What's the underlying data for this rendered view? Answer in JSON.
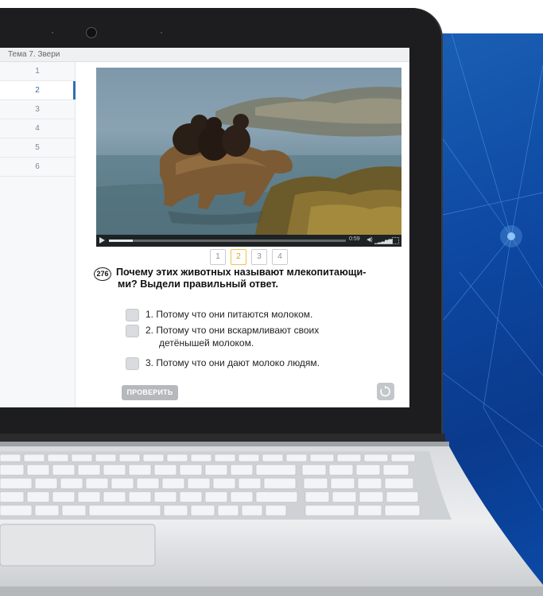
{
  "window": {
    "title": "Тема 7. Звери"
  },
  "sidebar": {
    "items": [
      {
        "label": "1",
        "active": false
      },
      {
        "label": "2",
        "active": true
      },
      {
        "label": "3",
        "active": false
      },
      {
        "label": "4",
        "active": false
      },
      {
        "label": "5",
        "active": false
      },
      {
        "label": "6",
        "active": false
      }
    ]
  },
  "video": {
    "time": "0:59",
    "progress": 0.1,
    "icons": [
      "play-icon",
      "volume-icon",
      "fullscreen-icon"
    ]
  },
  "pager": {
    "pages": [
      "1",
      "2",
      "3",
      "4"
    ],
    "active_page": "2"
  },
  "question": {
    "number": "276",
    "text_line1": "Почему этих животных называют млекопитающи-",
    "text_line2": "ми? Выдели правильный ответ.",
    "answers": [
      {
        "line1": "1. Потому что они питаются молоком.",
        "line2": ""
      },
      {
        "line1": "2. Потому что они вскармливают своих",
        "line2": "детёнышей молоком."
      },
      {
        "line1": "3. Потому что они дают молоко людям.",
        "line2": ""
      }
    ]
  },
  "buttons": {
    "check_label": "ПРОВЕРИТЬ",
    "reset_icon": "reset-icon"
  },
  "colors": {
    "accent_blue": "#2f6fb5",
    "active_page": "#f2c24b",
    "background_blue": "#0d47a1"
  }
}
